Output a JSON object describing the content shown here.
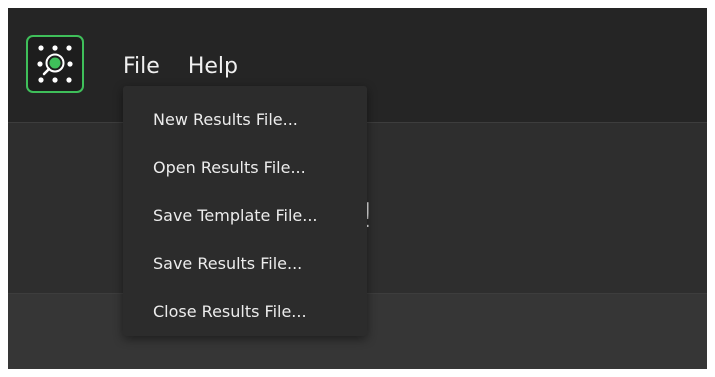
{
  "menubar": {
    "items": [
      "File",
      "Help"
    ]
  },
  "file_menu": {
    "items": [
      "New Results File...",
      "Open Results File...",
      "Save Template File...",
      "Save Results File...",
      "Close Results File..."
    ]
  },
  "main": {
    "welcome_partial": "e!"
  },
  "icons": {
    "app_logo": "app-logo-icon"
  },
  "colors": {
    "accent": "#3fbf5a",
    "background": "#2a2a2a"
  }
}
